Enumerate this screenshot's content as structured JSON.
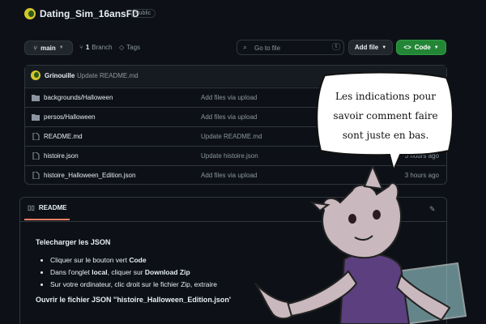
{
  "repo": {
    "name": "Dating_Sim_16ansFD",
    "visibility": "Public"
  },
  "toolbar": {
    "branch": "main",
    "branches_count": "1",
    "branches_label": "Branch",
    "tags_label": "Tags",
    "search_placeholder": "Go to file",
    "search_shortcut": "t",
    "add_file_label": "Add file",
    "code_label": "Code"
  },
  "commit": {
    "author": "Grinouille",
    "message": "Update README.md"
  },
  "files": [
    {
      "name": "backgrounds/Halloween",
      "type": "folder",
      "message": "Add files via upload",
      "time": ""
    },
    {
      "name": "persos/Halloween",
      "type": "folder",
      "message": "Add files via upload",
      "time": ""
    },
    {
      "name": "README.md",
      "type": "file",
      "message": "Update README.md",
      "time": ""
    },
    {
      "name": "histoire.json",
      "type": "file",
      "message": "Update histoire.json",
      "time": "3 hours ago"
    },
    {
      "name": "histoire_Halloween_Edition.json",
      "type": "file",
      "message": "Add files via upload",
      "time": "3 hours ago"
    }
  ],
  "readme": {
    "tab_label": "README",
    "heading1": "Telecharger les JSON",
    "list": [
      {
        "before": "Cliquer sur le bouton vert ",
        "bold": "Code",
        "after": ""
      },
      {
        "before": "Dans l'onglet ",
        "bold": "local",
        "after": ", cliquer sur ",
        "bold2": "Download Zip"
      },
      {
        "before": "Sur votre ordinateur, clic droit sur le fichier Zip, extraire",
        "bold": "",
        "after": ""
      }
    ],
    "heading2": "Ouvrir le fichier JSON ''histoire_Halloween_Edition.json'"
  },
  "speech_bubble": {
    "line1": "Les indications pour",
    "line2": "savoir comment faire",
    "line3": "sont juste en bas."
  },
  "colors": {
    "accent_green": "#238636",
    "border": "#30363d",
    "bg": "#0d1117",
    "character_fur": "#c9b8bd",
    "character_shirt": "#5b3f7e"
  }
}
